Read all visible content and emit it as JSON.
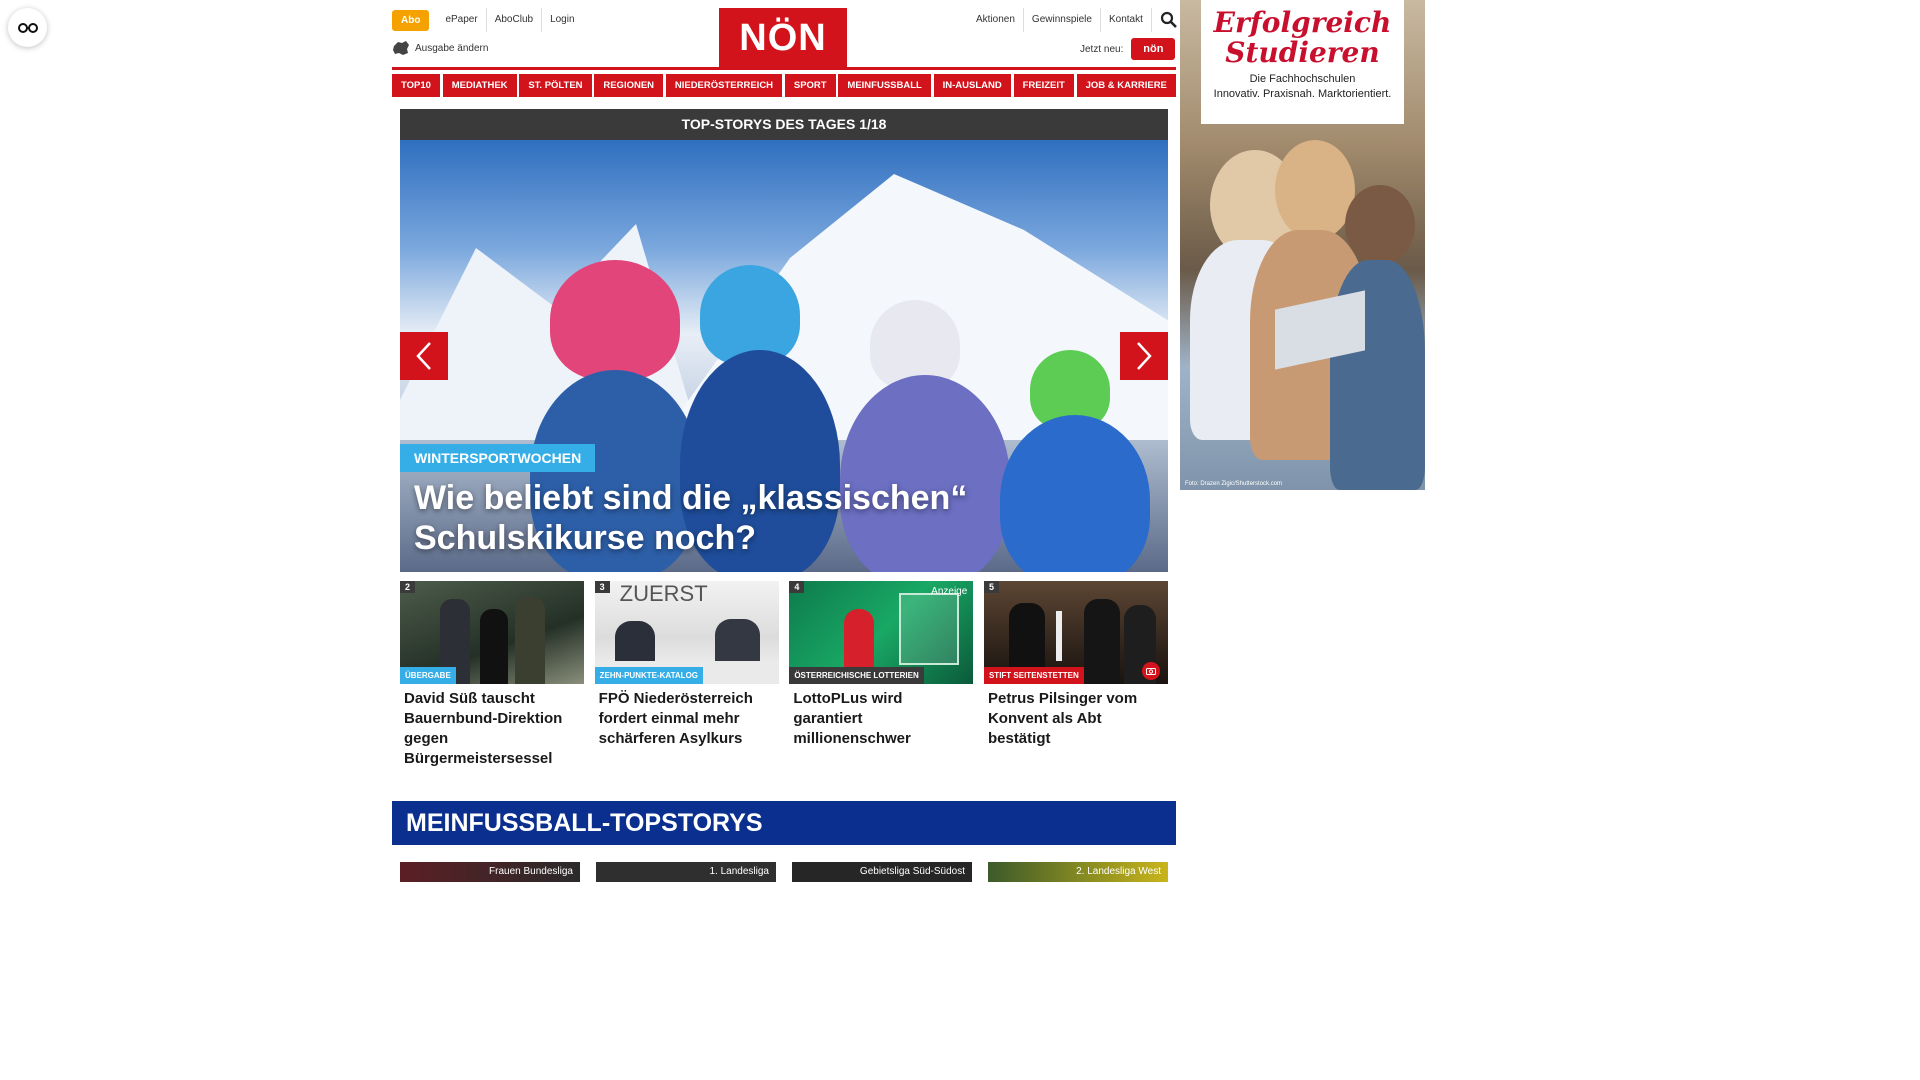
{
  "header": {
    "abo": "Abo",
    "top_links": [
      "ePaper",
      "AboClub",
      "Login"
    ],
    "ausgabe": "Ausgabe ändern",
    "logo": "NÖN",
    "right_links": [
      "Aktionen",
      "Gewinnspiele",
      "Kontakt"
    ],
    "jetzt_neu": "Jetzt neu:",
    "app_badge": "nön"
  },
  "nav": [
    "TOP10",
    "MEDIATHEK",
    "ST. PÖLTEN",
    "REGIONEN",
    "NIEDERÖSTERREICH",
    "SPORT",
    "MEINFUSSBALL",
    "IN-AUSLAND",
    "FREIZEIT",
    "JOB & KARRIERE"
  ],
  "slider": {
    "heading": "TOP-STORYS DES TAGES 1/18",
    "tag": "WINTERSPORTWOCHEN",
    "title": "Wie beliebt sind die „klassischen“ Schulskikurse noch?"
  },
  "cards": [
    {
      "num": "2",
      "tag": "ÜBERGABE",
      "tag_color": "#35aee8",
      "title": "David Süß tauscht Bauernbund-Direktion gegen Bürgermeistersessel",
      "anzeige": ""
    },
    {
      "num": "3",
      "tag": "ZEHN-PUNKTE-KATALOG",
      "tag_color": "#35aee8",
      "title": "FPÖ Niederösterreich fordert einmal mehr schärferen Asylkurs",
      "anzeige": ""
    },
    {
      "num": "4",
      "tag": "ÖSTERREICHISCHE LOTTERIEN",
      "tag_color": "#3a3a3a",
      "title": "LottoPLus wird garantiert millionenschwer",
      "anzeige": "Anzeige"
    },
    {
      "num": "5",
      "tag": "STIFT SEITENSTETTEN",
      "tag_color": "#d3131c",
      "title": "Petrus Pilsinger vom Konvent als Abt bestätigt",
      "anzeige": ""
    }
  ],
  "football": {
    "heading": "MEINFUSSBALL-TOPSTORYS",
    "leagues": [
      "Frauen Bundesliga",
      "1. Landesliga",
      "Gebietsliga Süd-Südost",
      "2. Landesliga West"
    ]
  },
  "ad": {
    "headline_1": "Erfolgreich",
    "headline_2": "Studieren",
    "sub_1": "Die Fachhochschulen",
    "sub_2": "Innovativ. Praxisnah. Marktorientiert.",
    "credit": "Foto: Drazen Zigic/Shutterstock.com"
  },
  "colors": {
    "brand_red": "#d3131c",
    "abo_orange": "#f5a200",
    "tag_blue": "#35aee8",
    "football_blue": "#0a2f8f"
  }
}
